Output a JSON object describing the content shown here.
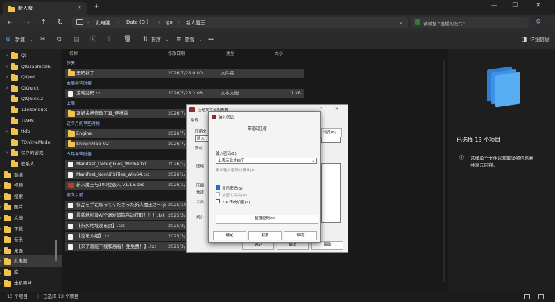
{
  "window": {
    "tab_title": "新人魔王",
    "new_tab_plus": "+",
    "controls": {
      "minimize": "—",
      "maximize": "☐",
      "close": "✕"
    }
  },
  "nav": {
    "back": "←",
    "forward": "→",
    "up": "↑",
    "refresh": "↻"
  },
  "breadcrumb": [
    "此电脑",
    "Data (D:)",
    "go",
    "新人魔王"
  ],
  "breadcrumb_sep": "›",
  "search": {
    "placeholder": "试试搜 \"模糊的照片\""
  },
  "toolbar": {
    "new_label": "新建",
    "sort_label": "排序",
    "view_label": "查看",
    "more_label": "···",
    "details_label": "详细信息"
  },
  "sidebar": {
    "items": [
      {
        "label": "Qt",
        "chev": "›"
      },
      {
        "label": "QtGraphicalE",
        "chev": "›"
      },
      {
        "label": "QtQml",
        "chev": "›"
      },
      {
        "label": "QtQuick",
        "chev": "›"
      },
      {
        "label": "QtQuick.2",
        "chev": ""
      },
      {
        "label": "11elements",
        "chev": ""
      },
      {
        "label": "TIARS",
        "chev": ""
      },
      {
        "label": "ttdb",
        "chev": "›"
      },
      {
        "label": "TOnlineMode",
        "chev": ""
      },
      {
        "label": "保存的游戏",
        "chev": "›"
      },
      {
        "label": "联系人",
        "chev": ""
      },
      {
        "label": "链接",
        "chev": ""
      },
      {
        "label": "视频",
        "chev": "›"
      },
      {
        "label": "搜索",
        "chev": "›"
      },
      {
        "label": "图片",
        "chev": "›"
      },
      {
        "label": "文档",
        "chev": "›"
      },
      {
        "label": "下载",
        "chev": "›"
      },
      {
        "label": "音乐",
        "chev": ""
      },
      {
        "label": "桌面",
        "chev": "›"
      },
      {
        "label": "此电脑",
        "chev": "›"
      },
      {
        "label": "库",
        "chev": "⌄"
      },
      {
        "label": "本机照片",
        "chev": "›"
      }
    ]
  },
  "columns": {
    "name": "名称",
    "date": "修改日期",
    "type": "类型",
    "size": "大小"
  },
  "groups": [
    {
      "label": "昨天",
      "rows": [
        {
          "name": "无码补丁",
          "date": "2026/7/25 0:00",
          "type": "文件夹",
          "size": "",
          "icon": "folder"
        }
      ]
    },
    {
      "label": "本周早些时候",
      "rows": [
        {
          "name": "游戏乱码.txt",
          "date": "2026/7/23 2:08",
          "type": "文本文档",
          "size": "1 KB",
          "icon": "doc"
        }
      ]
    },
    {
      "label": "上周",
      "rows": [
        {
          "name": "友好金格修改工具_便携版",
          "date": "2026/7/",
          "type": "",
          "size": "",
          "icon": "folder"
        }
      ]
    },
    {
      "label": "这个月的早些时候",
      "rows": [
        {
          "name": "Engine",
          "date": "2026/7/",
          "type": "",
          "size": "",
          "icon": "folder"
        },
        {
          "name": "ShinjinMao_02",
          "date": "2026/7/",
          "type": "",
          "size": "",
          "icon": "folder"
        }
      ]
    },
    {
      "label": "今年早些时候",
      "rows": [
        {
          "name": "Manifest_DebugFiles_Win64.txt",
          "date": "2026/1/",
          "type": "",
          "size": "",
          "icon": "doc"
        },
        {
          "name": "Manifest_NonUFSFiles_Win64.txt",
          "date": "2026/1/",
          "type": "",
          "size": "",
          "icon": "doc"
        },
        {
          "name": "新人魔王与100位恋人 v1.16.exe",
          "date": "2026/1/",
          "type": "",
          "size": "",
          "icon": "exe"
        }
      ]
    },
    {
      "label": "很久以前",
      "rows": [
        {
          "name": "作品を手に取ってくださった新人魔王さ～.p...",
          "date": "2025/10",
          "type": "",
          "size": "",
          "icon": "doc"
        },
        {
          "name": "最新地址及APP请发邮箱自动获取！！！.txt",
          "date": "2025/3/",
          "type": "",
          "size": "",
          "icon": "doc"
        },
        {
          "name": "【永久地址发布页】.txt",
          "date": "2025/3/",
          "type": "",
          "size": "",
          "icon": "doc"
        },
        {
          "name": "【论坛介绍】.txt",
          "date": "2025/3/",
          "type": "",
          "size": "",
          "icon": "doc"
        },
        {
          "name": "【来了就能下载和高看！免免费！】.txt",
          "date": "2025/3/",
          "type": "",
          "size": "",
          "icon": "doc"
        }
      ]
    }
  ],
  "detail": {
    "selected_title": "已选择 13 个项目",
    "info_text_1": "选择单个文件以获取详细信息并",
    "info_text_2": "共享云内容。"
  },
  "status": {
    "count": "13 个项目",
    "selected": "已选择 13 个项目"
  },
  "dialog_back": {
    "title": "压缩文件名和参数",
    "help": "?",
    "close": "✕",
    "tab_general": "常规",
    "label_archive": "压缩文",
    "label_new": "新人",
    "label_default": "默认",
    "label_format": "压缩",
    "label_method": "压缩",
    "label_speed": "快速",
    "label_dict": "字典",
    "label_split": "切分",
    "browse_btn": "浏览(B)...",
    "ok_btn": "确定",
    "cancel_btn": "取消",
    "help_btn": "帮助"
  },
  "dialog_pwd": {
    "title": "输入密码",
    "heading": "带密码压缩",
    "label_pwd": "输入密码(E)",
    "pwd_placeholder": "上表示此处由王",
    "label_confirm": "再次输入密码以确认(R)",
    "show_pwd": "显示密码(S)",
    "encrypt_names": "加密文件名(N)",
    "zip_legacy": "ZIP 传统加密(Z)",
    "manage_btn": "整理密码(O)...",
    "ok_btn": "确定",
    "cancel_btn": "取消",
    "help_btn": "帮助"
  },
  "colors": {
    "accent": "#1f6fd1",
    "folder": "#f2c14e",
    "selected_row": "#3a3a3a",
    "cube": "#4fa8f0"
  }
}
